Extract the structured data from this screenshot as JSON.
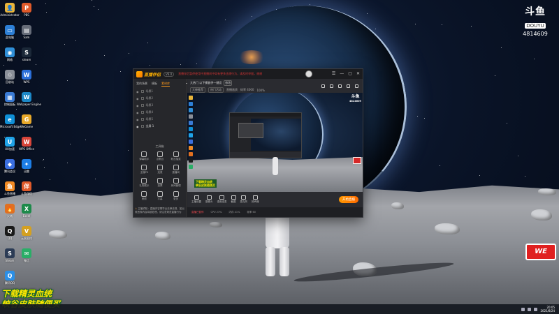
{
  "desktop": {
    "icons": [
      {
        "label": "Administrator",
        "glyph": "👤",
        "color": "#e8b43a"
      },
      {
        "label": "PBS",
        "glyph": "P",
        "color": "#e05a2a"
      },
      {
        "label": "此电脑",
        "glyph": "▭",
        "color": "#2d7fd6"
      },
      {
        "label": "Sam",
        "glyph": "▤",
        "color": "#666c78"
      },
      {
        "label": "网络",
        "glyph": "◉",
        "color": "#2f8fd8"
      },
      {
        "label": "steam",
        "glyph": "S",
        "color": "#1b2838"
      },
      {
        "label": "回收站",
        "glyph": "♲",
        "color": "#8a8f98"
      },
      {
        "label": "WPS",
        "glyph": "W",
        "color": "#2b6fd8"
      },
      {
        "label": "控制面板",
        "glyph": "▦",
        "color": "#3a7bd5"
      },
      {
        "label": "Wallpaper Engine",
        "glyph": "W",
        "color": "#1c88c7"
      },
      {
        "label": "Microsoft Edge",
        "glyph": "e",
        "color": "#0f8fd6"
      },
      {
        "label": "WeGame",
        "glyph": "G",
        "color": "#e8a92a"
      },
      {
        "label": "UU加速",
        "glyph": "U",
        "color": "#1fa3e8"
      },
      {
        "label": "WPS Office",
        "glyph": "W",
        "color": "#d8453a"
      },
      {
        "label": "腾讯会议",
        "glyph": "◆",
        "color": "#3b6fe0"
      },
      {
        "label": "迅雷",
        "glyph": "✦",
        "color": "#1d7ee6"
      },
      {
        "label": "斗鱼直播",
        "glyph": "鱼",
        "color": "#f08a24"
      },
      {
        "label": "斗鱼伴侣",
        "glyph": "伴",
        "color": "#e05a2a"
      },
      {
        "label": "火绒",
        "glyph": "🔥",
        "color": "#e07020"
      },
      {
        "label": "Excel",
        "glyph": "X",
        "color": "#1d8a4a"
      },
      {
        "label": "QQ",
        "glyph": "Q",
        "color": "#1a1a1a"
      },
      {
        "label": "无畏契约",
        "glyph": "V",
        "color": "#d4a020"
      },
      {
        "label": "Steam",
        "glyph": "S",
        "color": "#2b3b55"
      },
      {
        "label": "微信",
        "glyph": "✉",
        "color": "#2aae67"
      },
      {
        "label": "腾讯QQ",
        "glyph": "Q",
        "color": "#2b8fe6"
      }
    ]
  },
  "logo": {
    "name": "斗鱼",
    "sub": "DOUYU",
    "room_id": "4814609"
  },
  "app": {
    "title": "直播伴侣",
    "version": "V6.0",
    "notice": "直播伴侣暂停使用中直播间中如有更多违规行为，请及时举报，谢谢配合！",
    "titlebar_buttons": [
      "☰",
      "—",
      "▢",
      "✕"
    ],
    "left_tabs": [
      "我的场景",
      "模板",
      "素材库"
    ],
    "active_tab": 2,
    "scenes": [
      {
        "label": "场景1",
        "on": false
      },
      {
        "label": "场景2",
        "on": false
      },
      {
        "label": "场景3",
        "on": false
      },
      {
        "label": "场景4",
        "on": false
      },
      {
        "label": "场景5",
        "on": false
      },
      {
        "label": "全屏 1",
        "on": true
      }
    ],
    "tools_title": "工具箱",
    "tools": [
      "弹幕助手",
      "点歌台",
      "粉丝抽奖",
      "主播PK",
      "连麦",
      "直播间",
      "礼物展示",
      "投票",
      "房间管理",
      "美颜",
      "字幕",
      "更多"
    ],
    "bottom_notice": "主播须知：直播内容需符合法律法规，如出现违规内容将被处理，请注意规范直播行为",
    "room": {
      "title": "大热门  以下模板供一键设",
      "tag": "修改",
      "category": "大神推荐",
      "sub_category": "热门活动",
      "quality": "直播画质",
      "bitrate": "码率 4000",
      "zoom": "100%"
    },
    "preview": {
      "logo_top": "斗鱼",
      "logo_sub": "4814609",
      "promo_line1": "下载精灵血统",
      "promo_line2": "峡谷皮肤随便买"
    },
    "controls": [
      "主播设置",
      "摄像头",
      "语音连麦",
      "截图",
      "麦克风",
      "扬声器"
    ],
    "go_live": "开始直播",
    "status": [
      {
        "text": "直播已暂停",
        "red": true
      },
      {
        "text": "CPU 23%",
        "red": false
      },
      {
        "text": "内存 41%",
        "red": false
      },
      {
        "text": "帧率 60",
        "red": false
      }
    ]
  },
  "overlay": {
    "promo_line1": "下载精灵血统",
    "promo_line2": "峡谷皮肤随便买",
    "corner_badge": "WE"
  },
  "taskbar": {
    "time": "20:05",
    "date": "2021/8/24"
  }
}
